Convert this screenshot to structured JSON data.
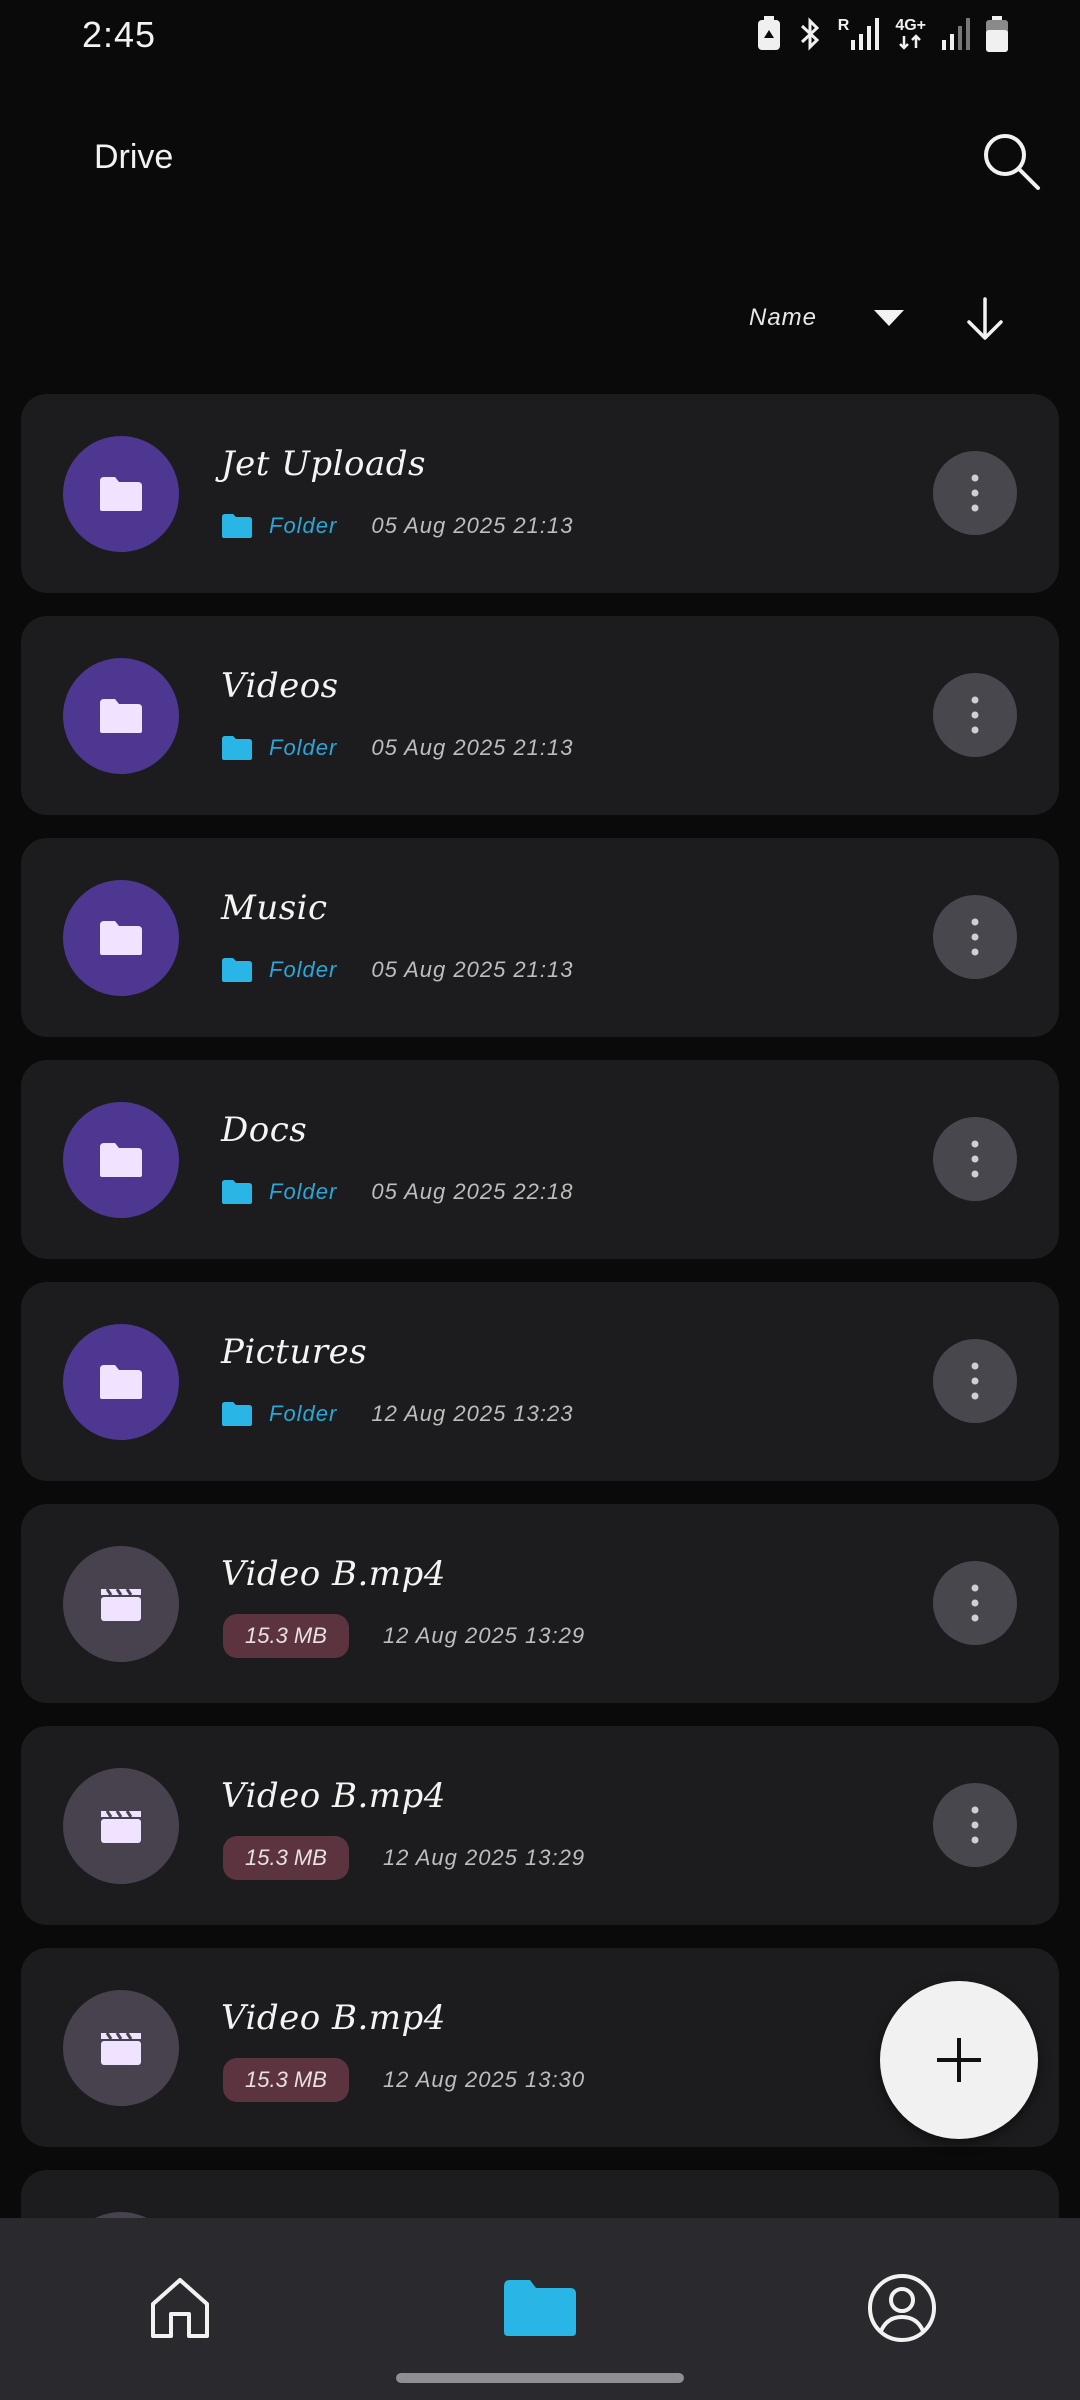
{
  "status_bar": {
    "time": "2:45",
    "network": "4G+",
    "roaming": "R",
    "icons": [
      "battery-saver-icon",
      "bluetooth-icon",
      "signal-icon",
      "network-4g-icon",
      "signal-icon",
      "battery-icon"
    ]
  },
  "header": {
    "title": "Drive",
    "search_icon": "search-icon"
  },
  "sort": {
    "label": "Name",
    "direction_icon": "arrow-down-icon"
  },
  "items": [
    {
      "name": "Jet Uploads",
      "kind": "folder",
      "type_label": "Folder",
      "date": "05 Aug 2025 21:13"
    },
    {
      "name": "Videos",
      "kind": "folder",
      "type_label": "Folder",
      "date": "05 Aug 2025 21:13"
    },
    {
      "name": "Music",
      "kind": "folder",
      "type_label": "Folder",
      "date": "05 Aug 2025 21:13"
    },
    {
      "name": "Docs",
      "kind": "folder",
      "type_label": "Folder",
      "date": "05 Aug 2025 22:18"
    },
    {
      "name": "Pictures",
      "kind": "folder",
      "type_label": "Folder",
      "date": "12 Aug 2025 13:23"
    },
    {
      "name": "Video B.mp4",
      "kind": "video",
      "size": "15.3 MB",
      "date": "12 Aug 2025 13:29"
    },
    {
      "name": "Video B.mp4",
      "kind": "video",
      "size": "15.3 MB",
      "date": "12 Aug 2025 13:29"
    },
    {
      "name": "Video B.mp4",
      "kind": "video",
      "size": "15.3 MB",
      "date": "12 Aug 2025 13:30"
    }
  ],
  "fab": {
    "icon": "plus-icon"
  },
  "bottom_nav": {
    "items": [
      {
        "id": "home",
        "icon": "home-icon"
      },
      {
        "id": "files",
        "icon": "folder-icon",
        "active": true
      },
      {
        "id": "profile",
        "icon": "profile-icon"
      }
    ]
  },
  "colors": {
    "background": "#0a0a0a",
    "card": "#1c1c1e",
    "folder_thumb": "#4d3790",
    "video_thumb": "#48424f",
    "accent": "#2ba6d8",
    "size_chip": "#5b3440",
    "nav_bg": "#2a2a2e"
  }
}
